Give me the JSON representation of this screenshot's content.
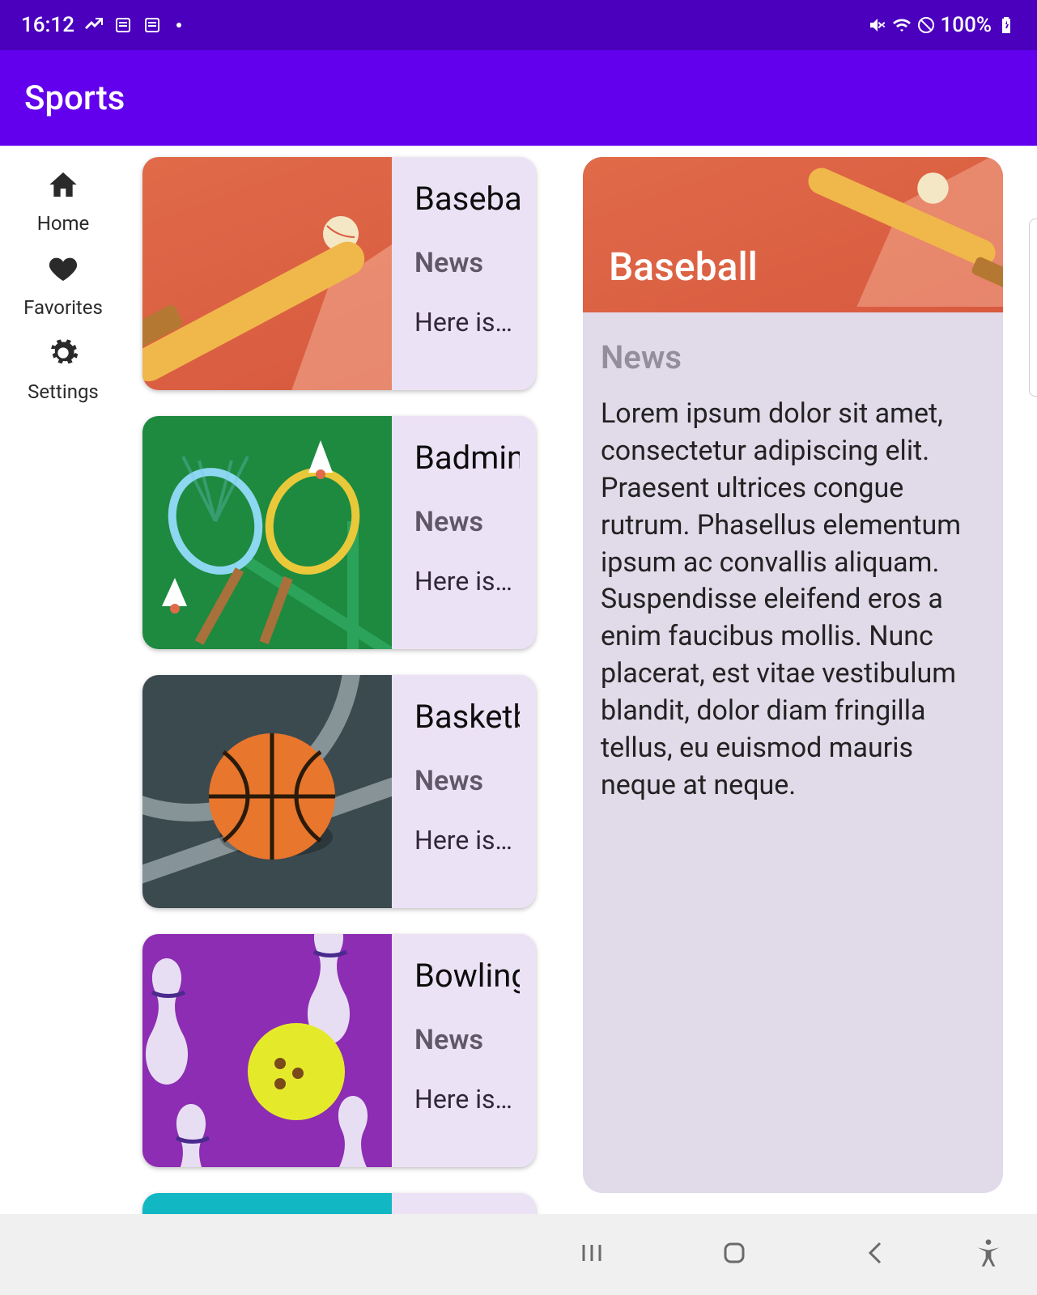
{
  "status": {
    "time": "16:12",
    "battery": "100%"
  },
  "app": {
    "title": "Sports"
  },
  "sidebar": {
    "items": [
      {
        "label": "Home"
      },
      {
        "label": "Favorites"
      },
      {
        "label": "Settings"
      }
    ]
  },
  "list": {
    "items": [
      {
        "title": "Baseball",
        "subtitle": "News",
        "preview": "Here is…",
        "image": "baseball"
      },
      {
        "title": "Badminton",
        "subtitle": "News",
        "preview": "Here is…",
        "image": "badminton"
      },
      {
        "title": "Basketball",
        "subtitle": "News",
        "preview": "Here is…",
        "image": "basketball"
      },
      {
        "title": "Bowling",
        "subtitle": "News",
        "preview": "Here is…",
        "image": "bowling"
      }
    ]
  },
  "detail": {
    "title": "Baseball",
    "subtitle": "News",
    "body": "Lorem ipsum dolor sit amet, consectetur adipiscing elit. Praesent ultrices congue rutrum. Phasellus elementum ipsum ac convallis aliquam. Suspendisse eleifend eros a enim faucibus mollis. Nunc placerat, est vitae vestibulum blandit, dolor diam fringilla tellus, eu euismod mauris neque at neque."
  }
}
